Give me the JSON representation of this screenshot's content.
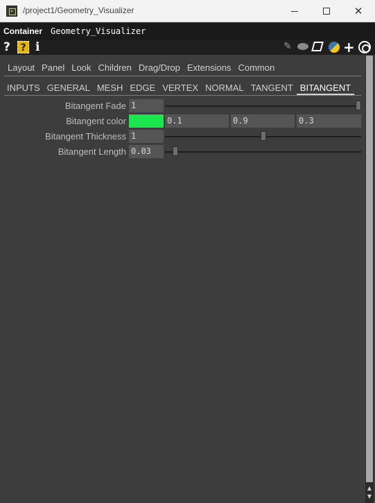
{
  "window": {
    "title": "/project1/Geometry_Visualizer",
    "min_icon": "minimize-icon",
    "max_icon": "maximize-icon",
    "close_icon": "close-icon",
    "close_glyph": "✕"
  },
  "header": {
    "type_label": "Container",
    "name": "Geometry_Visualizer"
  },
  "toolbar": {
    "help": "?",
    "help_box": "?",
    "info": "i",
    "pencil": "✎",
    "plus": "+"
  },
  "tabs_top": [
    {
      "label": "Layout"
    },
    {
      "label": "Panel"
    },
    {
      "label": "Look"
    },
    {
      "label": "Children"
    },
    {
      "label": "Drag/Drop"
    },
    {
      "label": "Extensions"
    },
    {
      "label": "Common"
    }
  ],
  "tabs_sub": [
    {
      "label": "INPUTS"
    },
    {
      "label": "GENERAL"
    },
    {
      "label": "MESH"
    },
    {
      "label": "EDGE"
    },
    {
      "label": "VERTEX"
    },
    {
      "label": "NORMAL"
    },
    {
      "label": "TANGENT"
    },
    {
      "label": "BITANGENT",
      "active": true
    }
  ],
  "params": {
    "fade": {
      "label": "Bitangent Fade",
      "value": "1",
      "slider_fraction": 1.0
    },
    "color": {
      "label": "Bitangent color",
      "r": "0.1",
      "g": "0.9",
      "b": "0.3",
      "swatch": "#1ae64d"
    },
    "thickness": {
      "label": "Bitangent Thickness",
      "value": "1",
      "slider_fraction": 0.5
    },
    "length": {
      "label": "Bitangent Length",
      "value": "0.03",
      "slider_fraction": 0.04
    }
  },
  "scrollbar": {
    "up": "▲",
    "down": "▼"
  },
  "colors": {
    "panel_bg": "#3d3d3d",
    "header_bg": "#1a1a1a",
    "accent_help": "#e8b400"
  }
}
